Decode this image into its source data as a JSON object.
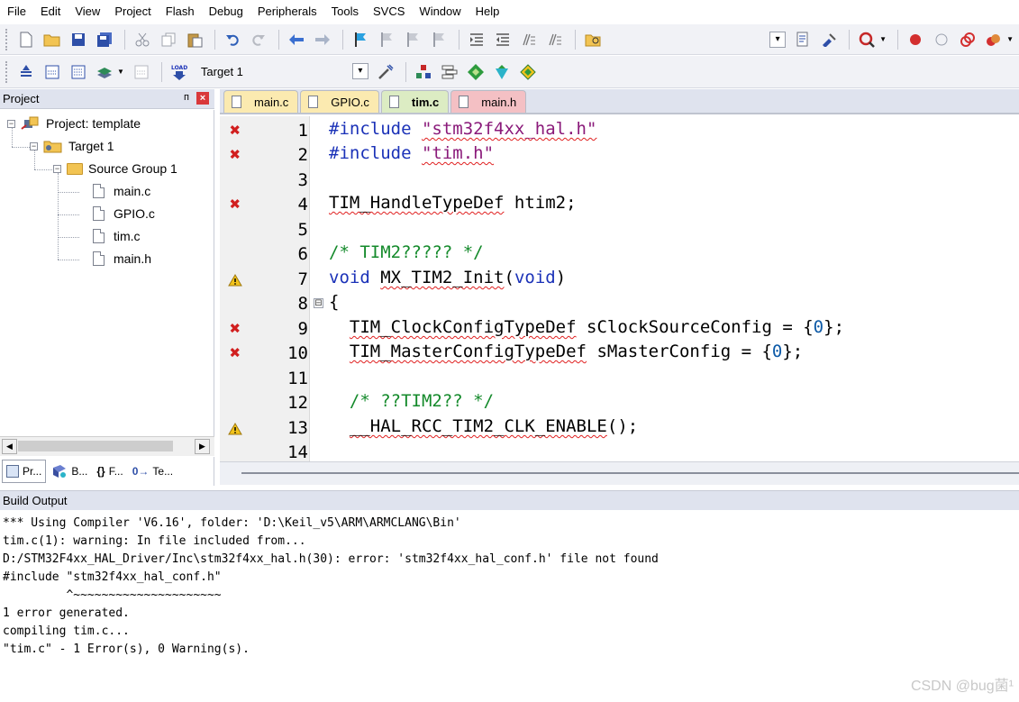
{
  "menu": [
    "File",
    "Edit",
    "View",
    "Project",
    "Flash",
    "Debug",
    "Peripherals",
    "Tools",
    "SVCS",
    "Window",
    "Help"
  ],
  "toolbar": {
    "target_name": "Target 1"
  },
  "project_panel": {
    "title": "Project",
    "pin": "ᴨ",
    "close": "×",
    "tree": {
      "project": "Project: template",
      "target": "Target 1",
      "group": "Source Group 1",
      "files": [
        "main.c",
        "GPIO.c",
        "tim.c",
        "main.h"
      ]
    },
    "tabs": [
      "Pr...",
      "B...",
      "F...",
      "Te..."
    ],
    "tab_prefixes": [
      "",
      "",
      "{}",
      "0→"
    ]
  },
  "editor": {
    "tabs": [
      {
        "label": "main.c",
        "kind": "c"
      },
      {
        "label": "GPIO.c",
        "kind": "c"
      },
      {
        "label": "tim.c",
        "kind": "cur"
      },
      {
        "label": "main.h",
        "kind": "h"
      }
    ],
    "lines": [
      {
        "n": "1",
        "mark": "error",
        "text": "#include \"stm32f4xx_hal.h\""
      },
      {
        "n": "2",
        "mark": "error",
        "text": "#include \"tim.h\""
      },
      {
        "n": "3",
        "mark": "",
        "text": ""
      },
      {
        "n": "4",
        "mark": "error",
        "text": "TIM_HandleTypeDef htim2;"
      },
      {
        "n": "5",
        "mark": "",
        "text": ""
      },
      {
        "n": "6",
        "mark": "",
        "text": "/* TIM2????? */"
      },
      {
        "n": "7",
        "mark": "warning",
        "text": "void MX_TIM2_Init(void)"
      },
      {
        "n": "8",
        "mark": "",
        "text": "{",
        "fold": "⊟"
      },
      {
        "n": "9",
        "mark": "error",
        "text": "  TIM_ClockConfigTypeDef sClockSourceConfig = {0};"
      },
      {
        "n": "10",
        "mark": "error",
        "text": "  TIM_MasterConfigTypeDef sMasterConfig = {0};"
      },
      {
        "n": "11",
        "mark": "",
        "text": ""
      },
      {
        "n": "12",
        "mark": "",
        "text": "  /* ??TIM2?? */"
      },
      {
        "n": "13",
        "mark": "warning",
        "text": "  __HAL_RCC_TIM2_CLK_ENABLE();"
      },
      {
        "n": "14",
        "mark": "",
        "text": ""
      }
    ],
    "tokens": {
      "l1_pp": "#include",
      "l1_str": "\"stm32f4xx_hal.h\"",
      "l2_pp": "#include",
      "l2_str": "\"tim.h\"",
      "l4_type": "TIM_HandleTypeDef",
      "l4_rest": " htim2;",
      "l6_cm": "/* TIM2????? */",
      "l7_kw1": "void",
      "l7_fn": "MX_TIM2_Init",
      "l7_p1": "(",
      "l7_kw2": "void",
      "l7_p2": ")",
      "l8": "{",
      "l9_type": "TIM_ClockConfigTypeDef",
      "l9_a": " sClockSourceConfig = {",
      "l9_num": "0",
      "l9_b": "};",
      "l10_type": "TIM_MasterConfigTypeDef",
      "l10_a": " sMasterConfig = {",
      "l10_num": "0",
      "l10_b": "};",
      "l12_cm": "/* ??TIM2?? */",
      "l13_fn": "__HAL_RCC_TIM2_CLK_ENABLE",
      "l13_rest": "();"
    }
  },
  "build_output": {
    "title": "Build Output",
    "lines": [
      "*** Using Compiler 'V6.16', folder: 'D:\\Keil_v5\\ARM\\ARMCLANG\\Bin'",
      "tim.c(1): warning: In file included from...",
      "D:/STM32F4xx_HAL_Driver/Inc\\stm32f4xx_hal.h(30): error: 'stm32f4xx_hal_conf.h' file not found",
      "#include \"stm32f4xx_hal_conf.h\"",
      "         ^~~~~~~~~~~~~~~~~~~~~~",
      "1 error generated.",
      "compiling tim.c...",
      "\"tim.c\" - 1 Error(s), 0 Warning(s)."
    ]
  },
  "watermark": "CSDN @bug菌¹",
  "colors": {
    "error_mark": "#d11f1f",
    "warning_mark": "#f2c31b",
    "keyword": "#1b32b8",
    "comment": "#148a2b",
    "string": "#8a1a7a"
  }
}
